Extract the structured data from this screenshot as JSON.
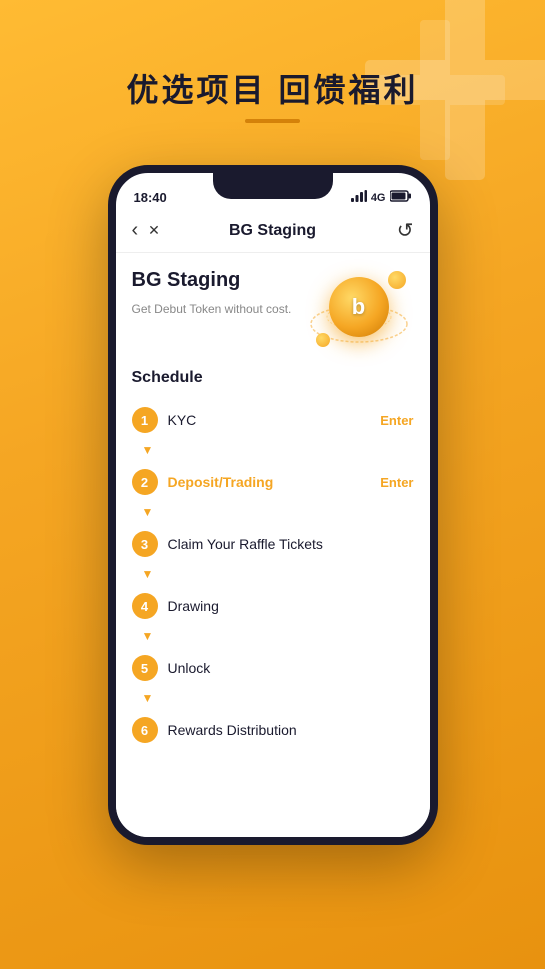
{
  "background": {
    "color": "#F5A623"
  },
  "top_heading": {
    "text": "优选项目 回馈福利"
  },
  "status_bar": {
    "time": "18:40",
    "signal": "▪▪▪",
    "network": "4G",
    "battery": "🔋"
  },
  "nav": {
    "title": "BG Staging",
    "back_icon": "‹",
    "close_icon": "✕",
    "refresh_icon": "↺"
  },
  "hero": {
    "title": "BG Staging",
    "subtitle": "Get Debut Token without cost."
  },
  "schedule": {
    "title": "Schedule",
    "items": [
      {
        "number": "1",
        "label": "KYC",
        "active": false,
        "has_enter": true,
        "enter_label": "Enter"
      },
      {
        "number": "2",
        "label": "Deposit/Trading",
        "active": true,
        "has_enter": true,
        "enter_label": "Enter"
      },
      {
        "number": "3",
        "label": "Claim Your Raffle Tickets",
        "active": false,
        "has_enter": false,
        "enter_label": ""
      },
      {
        "number": "4",
        "label": "Drawing",
        "active": false,
        "has_enter": false,
        "enter_label": ""
      },
      {
        "number": "5",
        "label": "Unlock",
        "active": false,
        "has_enter": false,
        "enter_label": ""
      },
      {
        "number": "6",
        "label": "Rewards Distribution",
        "active": false,
        "has_enter": false,
        "enter_label": ""
      }
    ]
  }
}
